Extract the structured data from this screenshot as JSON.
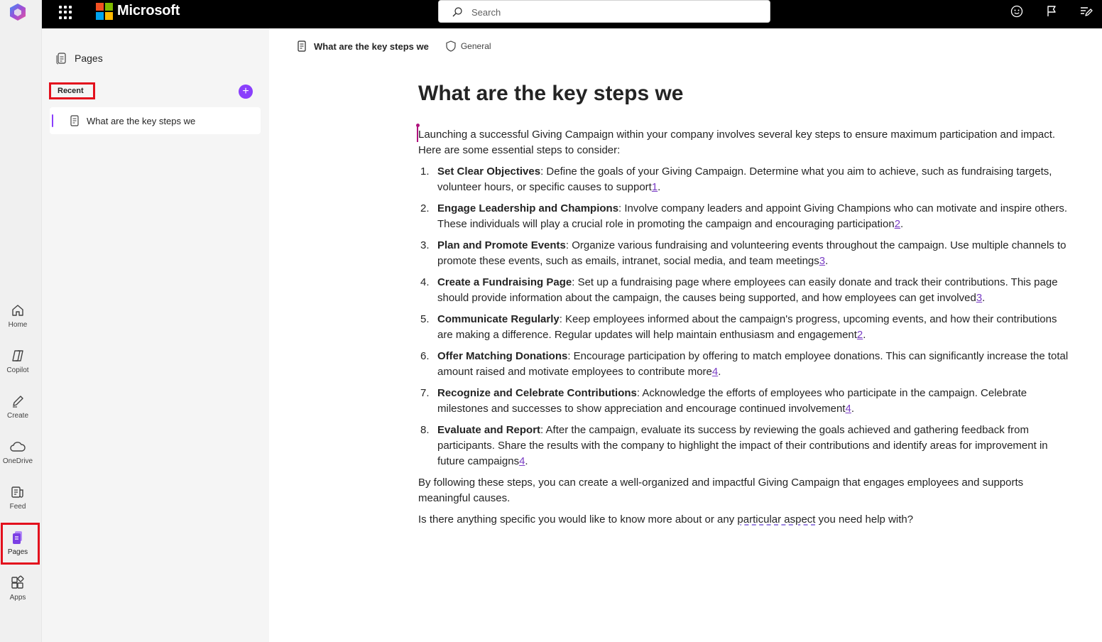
{
  "app": {
    "brand_name": "Microsoft"
  },
  "search": {
    "placeholder": "Search"
  },
  "rail": {
    "items": [
      {
        "label": "Home",
        "icon": "home-icon"
      },
      {
        "label": "Copilot",
        "icon": "copilot-icon"
      },
      {
        "label": "Create",
        "icon": "pen-icon"
      },
      {
        "label": "OneDrive",
        "icon": "cloud-icon"
      },
      {
        "label": "Feed",
        "icon": "feed-icon"
      },
      {
        "label": "Pages",
        "icon": "pages-icon",
        "active": true
      },
      {
        "label": "Apps",
        "icon": "apps-icon"
      }
    ]
  },
  "panel": {
    "title": "Pages",
    "recent_label": "Recent",
    "add_symbol": "+",
    "recent_items": [
      {
        "label": "What are the key steps we"
      }
    ]
  },
  "doc": {
    "breadcrumb_name": "What are the key steps we",
    "sensitivity": "General",
    "title": "What are the key steps we",
    "intro": "Launching a successful Giving Campaign within your company involves several key steps to ensure maximum participation and impact. Here are some essential steps to consider:",
    "steps": [
      {
        "num": "1.",
        "title": "Set Clear Objectives",
        "text": ": Define the goals of your Giving Campaign. Determine what you aim to achieve, such as fundraising targets, volunteer hours, or specific causes to support",
        "cite": "1"
      },
      {
        "num": "2.",
        "title": "Engage Leadership and Champions",
        "text": ": Involve company leaders and appoint Giving Champions who can motivate and inspire others. These individuals will play a crucial role in promoting the campaign and encouraging participation",
        "cite": "2"
      },
      {
        "num": "3.",
        "title": "Plan and Promote Events",
        "text": ": Organize various fundraising and volunteering events throughout the campaign. Use multiple channels to promote these events, such as emails, intranet, social media, and team meetings",
        "cite": "3"
      },
      {
        "num": "4.",
        "title": "Create a Fundraising Page",
        "text": ": Set up a fundraising page where employees can easily donate and track their contributions. This page should provide information about the campaign, the causes being supported, and how employees can get involved",
        "cite": "3"
      },
      {
        "num": "5.",
        "title": "Communicate Regularly",
        "text": ": Keep employees informed about the campaign's progress, upcoming events, and how their contributions are making a difference. Regular updates will help maintain enthusiasm and engagement",
        "cite": "2"
      },
      {
        "num": "6.",
        "title": "Offer Matching Donations",
        "text": ": Encourage participation by offering to match employee donations. This can significantly increase the total amount raised and motivate employees to contribute more",
        "cite": "4"
      },
      {
        "num": "7.",
        "title": "Recognize and Celebrate Contributions",
        "text": ": Acknowledge the efforts of employees who participate in the campaign. Celebrate milestones and successes to show appreciation and encourage continued involvement",
        "cite": "4"
      },
      {
        "num": "8.",
        "title": "Evaluate and Report",
        "text": ": After the campaign, evaluate its success by reviewing the goals achieved and gathering feedback from participants. Share the results with the company to highlight the impact of their contributions and identify areas for improvement in future campaigns",
        "cite": "4"
      }
    ],
    "closing": "By following these steps, you can create a well-organized and impactful Giving Campaign that engages employees and supports meaningful causes.",
    "question_pre": "Is there anything specific you would like to know more about or any ",
    "question_flag": "particular aspect",
    "question_post": " you need help with?"
  },
  "colors": {
    "accent": "#8a3ffc",
    "highlight": "#e3101d",
    "topbar": "#000000"
  }
}
